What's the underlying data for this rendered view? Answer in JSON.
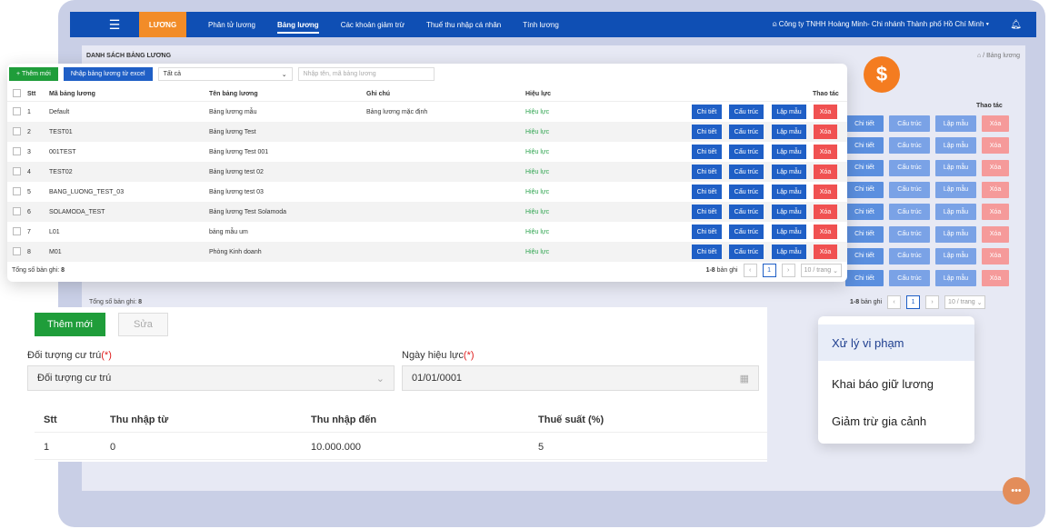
{
  "nav": {
    "menu_icon": "☰",
    "brand": "LƯƠNG",
    "items": [
      "Phân tử lương",
      "Bảng lương",
      "Các khoản giảm trừ",
      "Thuế thu nhập cá nhân",
      "Tính lương"
    ],
    "active_index": 1,
    "company": "Công ty TNHH Hoàng Minh- Chi nhánh Thành phố Hồ Chí Minh",
    "company_icon": "user-icon",
    "bell_icon": "bell-icon"
  },
  "background": {
    "title": "DANH SÁCH BẢNG LƯƠNG",
    "breadcrumb": "Bảng lương",
    "actions_header": "Thao tác",
    "actions": [
      "Chi tiết",
      "Cấu trúc",
      "Lập mẫu",
      "Xóa"
    ],
    "total_label": "Tổng số bản ghi:",
    "total": "8",
    "pager_count": "1-8",
    "pager_count_label": "bản ghi",
    "page": "1",
    "page_size": "10 / trang"
  },
  "card": {
    "add_label": "Thêm mới",
    "import_label": "Nhập bảng lương từ excel",
    "filter_value": "Tất cả",
    "search_placeholder": "Nhập tên, mã bảng lương",
    "headers": {
      "stt": "Stt",
      "code": "Mã bảng lương",
      "name": "Tên bảng lương",
      "note": "Ghi chú",
      "status": "Hiệu lực",
      "actions": "Thao tác"
    },
    "rows": [
      {
        "stt": "1",
        "code": "Default",
        "name": "Bảng lương mẫu",
        "note": "Bảng lương mặc định",
        "status": "Hiệu lực"
      },
      {
        "stt": "2",
        "code": "TEST01",
        "name": "Bảng lương Test",
        "note": "",
        "status": "Hiệu lực"
      },
      {
        "stt": "3",
        "code": "001TEST",
        "name": "Bảng lương Test 001",
        "note": "",
        "status": "Hiệu lực"
      },
      {
        "stt": "4",
        "code": "TEST02",
        "name": "Bảng lương test 02",
        "note": "",
        "status": "Hiệu lực"
      },
      {
        "stt": "5",
        "code": "BANG_LUONG_TEST_03",
        "name": "Bảng lương test 03",
        "note": "",
        "status": "Hiệu lực"
      },
      {
        "stt": "6",
        "code": "SOLAMODA_TEST",
        "name": "Bảng lương Test Solamoda",
        "note": "",
        "status": "Hiệu lực"
      },
      {
        "stt": "7",
        "code": "L01",
        "name": "bảng mẫu um",
        "note": "",
        "status": "Hiệu lực"
      },
      {
        "stt": "8",
        "code": "M01",
        "name": "Phòng Kinh doanh",
        "note": "",
        "status": "Hiệu lực"
      }
    ],
    "actions": [
      "Chi tiết",
      "Cấu trúc",
      "Lập mẫu",
      "Xóa"
    ],
    "total_label": "Tổng số bản ghi:",
    "total": "8",
    "pager_count": "1-8",
    "pager_count_label": "bản ghi",
    "page": "1",
    "page_size": "10 / trang"
  },
  "coin_symbol": "$",
  "form": {
    "new_label": "Thêm mới",
    "edit_label": "Sửa",
    "resident_label": "Đối tượng cư trú",
    "resident_value": "Đối tượng cư trú",
    "effective_label": "Ngày hiệu lực",
    "effective_value": "01/01/0001",
    "required_mark": "(*)",
    "headers": {
      "stt": "Stt",
      "from": "Thu nhập từ",
      "to": "Thu nhập đến",
      "rate": "Thuế suất (%)"
    },
    "rows": [
      {
        "stt": "1",
        "from": "0",
        "to": "10.000.000",
        "rate": "5"
      }
    ]
  },
  "popup": {
    "items": [
      "Xử lý vi phạm",
      "Khai báo giữ lương",
      "Giảm trừ gia cảnh"
    ],
    "selected_index": 0
  },
  "colors": {
    "brand": "#f28c28",
    "nav": "#0f4fb4",
    "add": "#1f9d3a",
    "primary": "#1f5fc6",
    "danger": "#f05151",
    "valid": "#2ea44f"
  }
}
